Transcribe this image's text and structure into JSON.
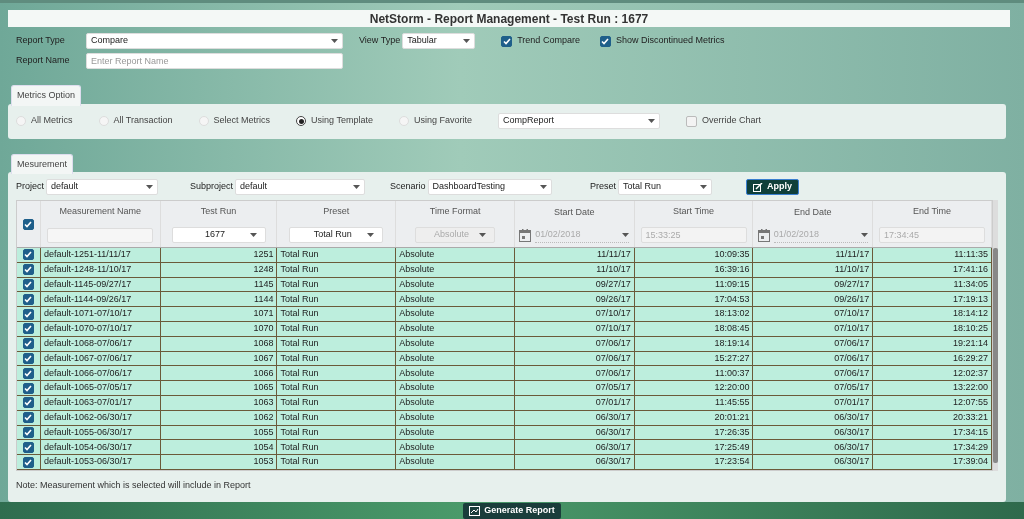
{
  "window": {
    "title": "NetStorm - Report Management - Test Run : 1677"
  },
  "report_type": {
    "label": "Report Type",
    "value": "Compare"
  },
  "view_type": {
    "label": "View Type",
    "value": "Tabular"
  },
  "options": [
    {
      "label": "Trend Compare",
      "checked": true
    },
    {
      "label": "Show Discontinued Metrics",
      "checked": true
    }
  ],
  "report_name": {
    "label": "Report Name",
    "placeholder": "Enter Report Name"
  },
  "metrics_option": {
    "legend": "Metrics Option",
    "radios": [
      {
        "label": "All Metrics",
        "selected": false
      },
      {
        "label": "All Transaction",
        "selected": false
      },
      {
        "label": "Select Metrics",
        "selected": false
      },
      {
        "label": "Using Template",
        "selected": true
      },
      {
        "label": "Using Favorite",
        "selected": false
      }
    ],
    "template": "CompReport",
    "override_chart": {
      "label": "Override Chart",
      "checked": false
    }
  },
  "measurement": {
    "legend": "Mesurement",
    "filters": [
      {
        "label": "Project",
        "value": "default"
      },
      {
        "label": "Subproject",
        "value": "default"
      },
      {
        "label": "Scenario",
        "value": "DashboardTesting"
      },
      {
        "label": "Preset",
        "value": "Total Run"
      }
    ],
    "apply": "Apply",
    "all_checked": true,
    "columns": [
      {
        "label": "Measurement Name",
        "kind": "text"
      },
      {
        "label": "Test Run",
        "kind": "select",
        "value": "1677"
      },
      {
        "label": "Preset",
        "kind": "select",
        "value": "Total Run"
      },
      {
        "label": "Time Format",
        "kind": "disabled_select",
        "value": "Absolute"
      },
      {
        "label": "Start Date",
        "kind": "date",
        "value": "01/02/2018"
      },
      {
        "label": "Start Time",
        "kind": "time",
        "value": "15:33:25"
      },
      {
        "label": "End Date",
        "kind": "date",
        "value": "01/02/2018"
      },
      {
        "label": "End Time",
        "kind": "time",
        "value": "17:34:45"
      }
    ],
    "rows": [
      {
        "checked": true,
        "cells": [
          "default-1251-11/11/17",
          "1251",
          "Total Run",
          "Absolute",
          "11/11/17",
          "10:09:35",
          "11/11/17",
          "11:11:35"
        ]
      },
      {
        "checked": true,
        "cells": [
          "default-1248-11/10/17",
          "1248",
          "Total Run",
          "Absolute",
          "11/10/17",
          "16:39:16",
          "11/10/17",
          "17:41:16"
        ]
      },
      {
        "checked": true,
        "cells": [
          "default-1145-09/27/17",
          "1145",
          "Total Run",
          "Absolute",
          "09/27/17",
          "11:09:15",
          "09/27/17",
          "11:34:05"
        ]
      },
      {
        "checked": true,
        "cells": [
          "default-1144-09/26/17",
          "1144",
          "Total Run",
          "Absolute",
          "09/26/17",
          "17:04:53",
          "09/26/17",
          "17:19:13"
        ]
      },
      {
        "checked": true,
        "cells": [
          "default-1071-07/10/17",
          "1071",
          "Total Run",
          "Absolute",
          "07/10/17",
          "18:13:02",
          "07/10/17",
          "18:14:12"
        ]
      },
      {
        "checked": true,
        "cells": [
          "default-1070-07/10/17",
          "1070",
          "Total Run",
          "Absolute",
          "07/10/17",
          "18:08:45",
          "07/10/17",
          "18:10:25"
        ]
      },
      {
        "checked": true,
        "cells": [
          "default-1068-07/06/17",
          "1068",
          "Total Run",
          "Absolute",
          "07/06/17",
          "18:19:14",
          "07/06/17",
          "19:21:14"
        ]
      },
      {
        "checked": true,
        "cells": [
          "default-1067-07/06/17",
          "1067",
          "Total Run",
          "Absolute",
          "07/06/17",
          "15:27:27",
          "07/06/17",
          "16:29:27"
        ]
      },
      {
        "checked": true,
        "cells": [
          "default-1066-07/06/17",
          "1066",
          "Total Run",
          "Absolute",
          "07/06/17",
          "11:00:37",
          "07/06/17",
          "12:02:37"
        ]
      },
      {
        "checked": true,
        "cells": [
          "default-1065-07/05/17",
          "1065",
          "Total Run",
          "Absolute",
          "07/05/17",
          "12:20:00",
          "07/05/17",
          "13:22:00"
        ]
      },
      {
        "checked": true,
        "cells": [
          "default-1063-07/01/17",
          "1063",
          "Total Run",
          "Absolute",
          "07/01/17",
          "11:45:55",
          "07/01/17",
          "12:07:55"
        ]
      },
      {
        "checked": true,
        "cells": [
          "default-1062-06/30/17",
          "1062",
          "Total Run",
          "Absolute",
          "06/30/17",
          "20:01:21",
          "06/30/17",
          "20:33:21"
        ]
      },
      {
        "checked": true,
        "cells": [
          "default-1055-06/30/17",
          "1055",
          "Total Run",
          "Absolute",
          "06/30/17",
          "17:26:35",
          "06/30/17",
          "17:34:15"
        ]
      },
      {
        "checked": true,
        "cells": [
          "default-1054-06/30/17",
          "1054",
          "Total Run",
          "Absolute",
          "06/30/17",
          "17:25:49",
          "06/30/17",
          "17:34:29"
        ]
      },
      {
        "checked": true,
        "cells": [
          "default-1053-06/30/17",
          "1053",
          "Total Run",
          "Absolute",
          "06/30/17",
          "17:23:54",
          "06/30/17",
          "17:39:04"
        ]
      }
    ],
    "note": "Note: Measurement which is selected will include in Report"
  },
  "generate": "Generate Report"
}
